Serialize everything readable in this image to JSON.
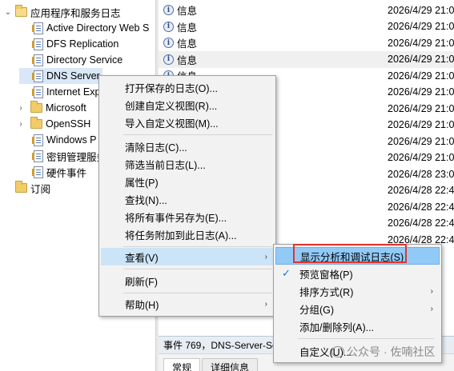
{
  "tree": {
    "parent": "应用程序和服务日志",
    "items": [
      {
        "label": "Active Directory Web S",
        "kind": "log"
      },
      {
        "label": "DFS Replication",
        "kind": "log"
      },
      {
        "label": "Directory Service",
        "kind": "log"
      },
      {
        "label": "DNS Server",
        "kind": "log"
      },
      {
        "label": "Internet Exp",
        "kind": "log"
      },
      {
        "label": "Microsoft",
        "kind": "folder"
      },
      {
        "label": "OpenSSH",
        "kind": "folder"
      },
      {
        "label": "Windows P",
        "kind": "log"
      },
      {
        "label": "密钥管理服务",
        "kind": "log"
      },
      {
        "label": "硬件事件",
        "kind": "log"
      }
    ],
    "subscriptions": "订阅"
  },
  "events": {
    "level": "信息",
    "rows": [
      {
        "level": "信息",
        "date": "2026/4/29 21:0"
      },
      {
        "level": "信息",
        "date": "2026/4/29 21:0"
      },
      {
        "level": "信息",
        "date": "2026/4/29 21:0"
      },
      {
        "level": "信息",
        "date": "2026/4/29 21:0"
      },
      {
        "level": "信息",
        "date": "2026/4/29 21:0"
      },
      {
        "level": "信息",
        "date": "2026/4/29 21:0"
      },
      {
        "level": "信息",
        "date": "2026/4/29 21:0"
      },
      {
        "level": "信息",
        "date": "2026/4/29 21:0"
      },
      {
        "level": "信息",
        "date": "2026/4/29 21:0"
      },
      {
        "level": "信息",
        "date": "2026/4/29 21:0"
      },
      {
        "level": "信息",
        "date": "2026/4/28 23:0"
      },
      {
        "level": "信息",
        "date": "2026/4/28 22:4"
      },
      {
        "level": "信息",
        "date": "2026/4/28 22:4"
      },
      {
        "level": "信息",
        "date": "2026/4/28 22:4"
      },
      {
        "level": "信息",
        "date": "2026/4/28 22:4"
      }
    ]
  },
  "detail": {
    "header": "事件 769，DNS-Server-Se",
    "tab_general": "常规",
    "tab_details": "详细信息"
  },
  "context_menu": {
    "items": [
      {
        "label": "打开保存的日志(O)..."
      },
      {
        "label": "创建自定义视图(R)..."
      },
      {
        "label": "导入自定义视图(M)..."
      },
      {
        "label": "清除日志(C)..."
      },
      {
        "label": "筛选当前日志(L)..."
      },
      {
        "label": "属性(P)"
      },
      {
        "label": "查找(N)..."
      },
      {
        "label": "将所有事件另存为(E)..."
      },
      {
        "label": "将任务附加到此日志(A)..."
      },
      {
        "label": "查看(V)",
        "submenu": true,
        "highlighted": true
      },
      {
        "label": "刷新(F)"
      },
      {
        "label": "帮助(H)",
        "submenu": true
      }
    ]
  },
  "view_submenu": {
    "items": [
      {
        "label": "显示分析和调试日志(S)",
        "highlighted": true
      },
      {
        "label": "预览窗格(P)",
        "checked": true
      },
      {
        "label": "排序方式(R)",
        "submenu": true
      },
      {
        "label": "分组(G)",
        "submenu": true
      },
      {
        "label": "添加/删除列(A)..."
      },
      {
        "label": "自定义(U)..."
      }
    ]
  },
  "watermark": "公众号 · 佐喃社区",
  "colors": {
    "menu_highlight": "#cce4f7",
    "callout_border": "#e2322f",
    "check_mark": "#1a6fd0"
  }
}
